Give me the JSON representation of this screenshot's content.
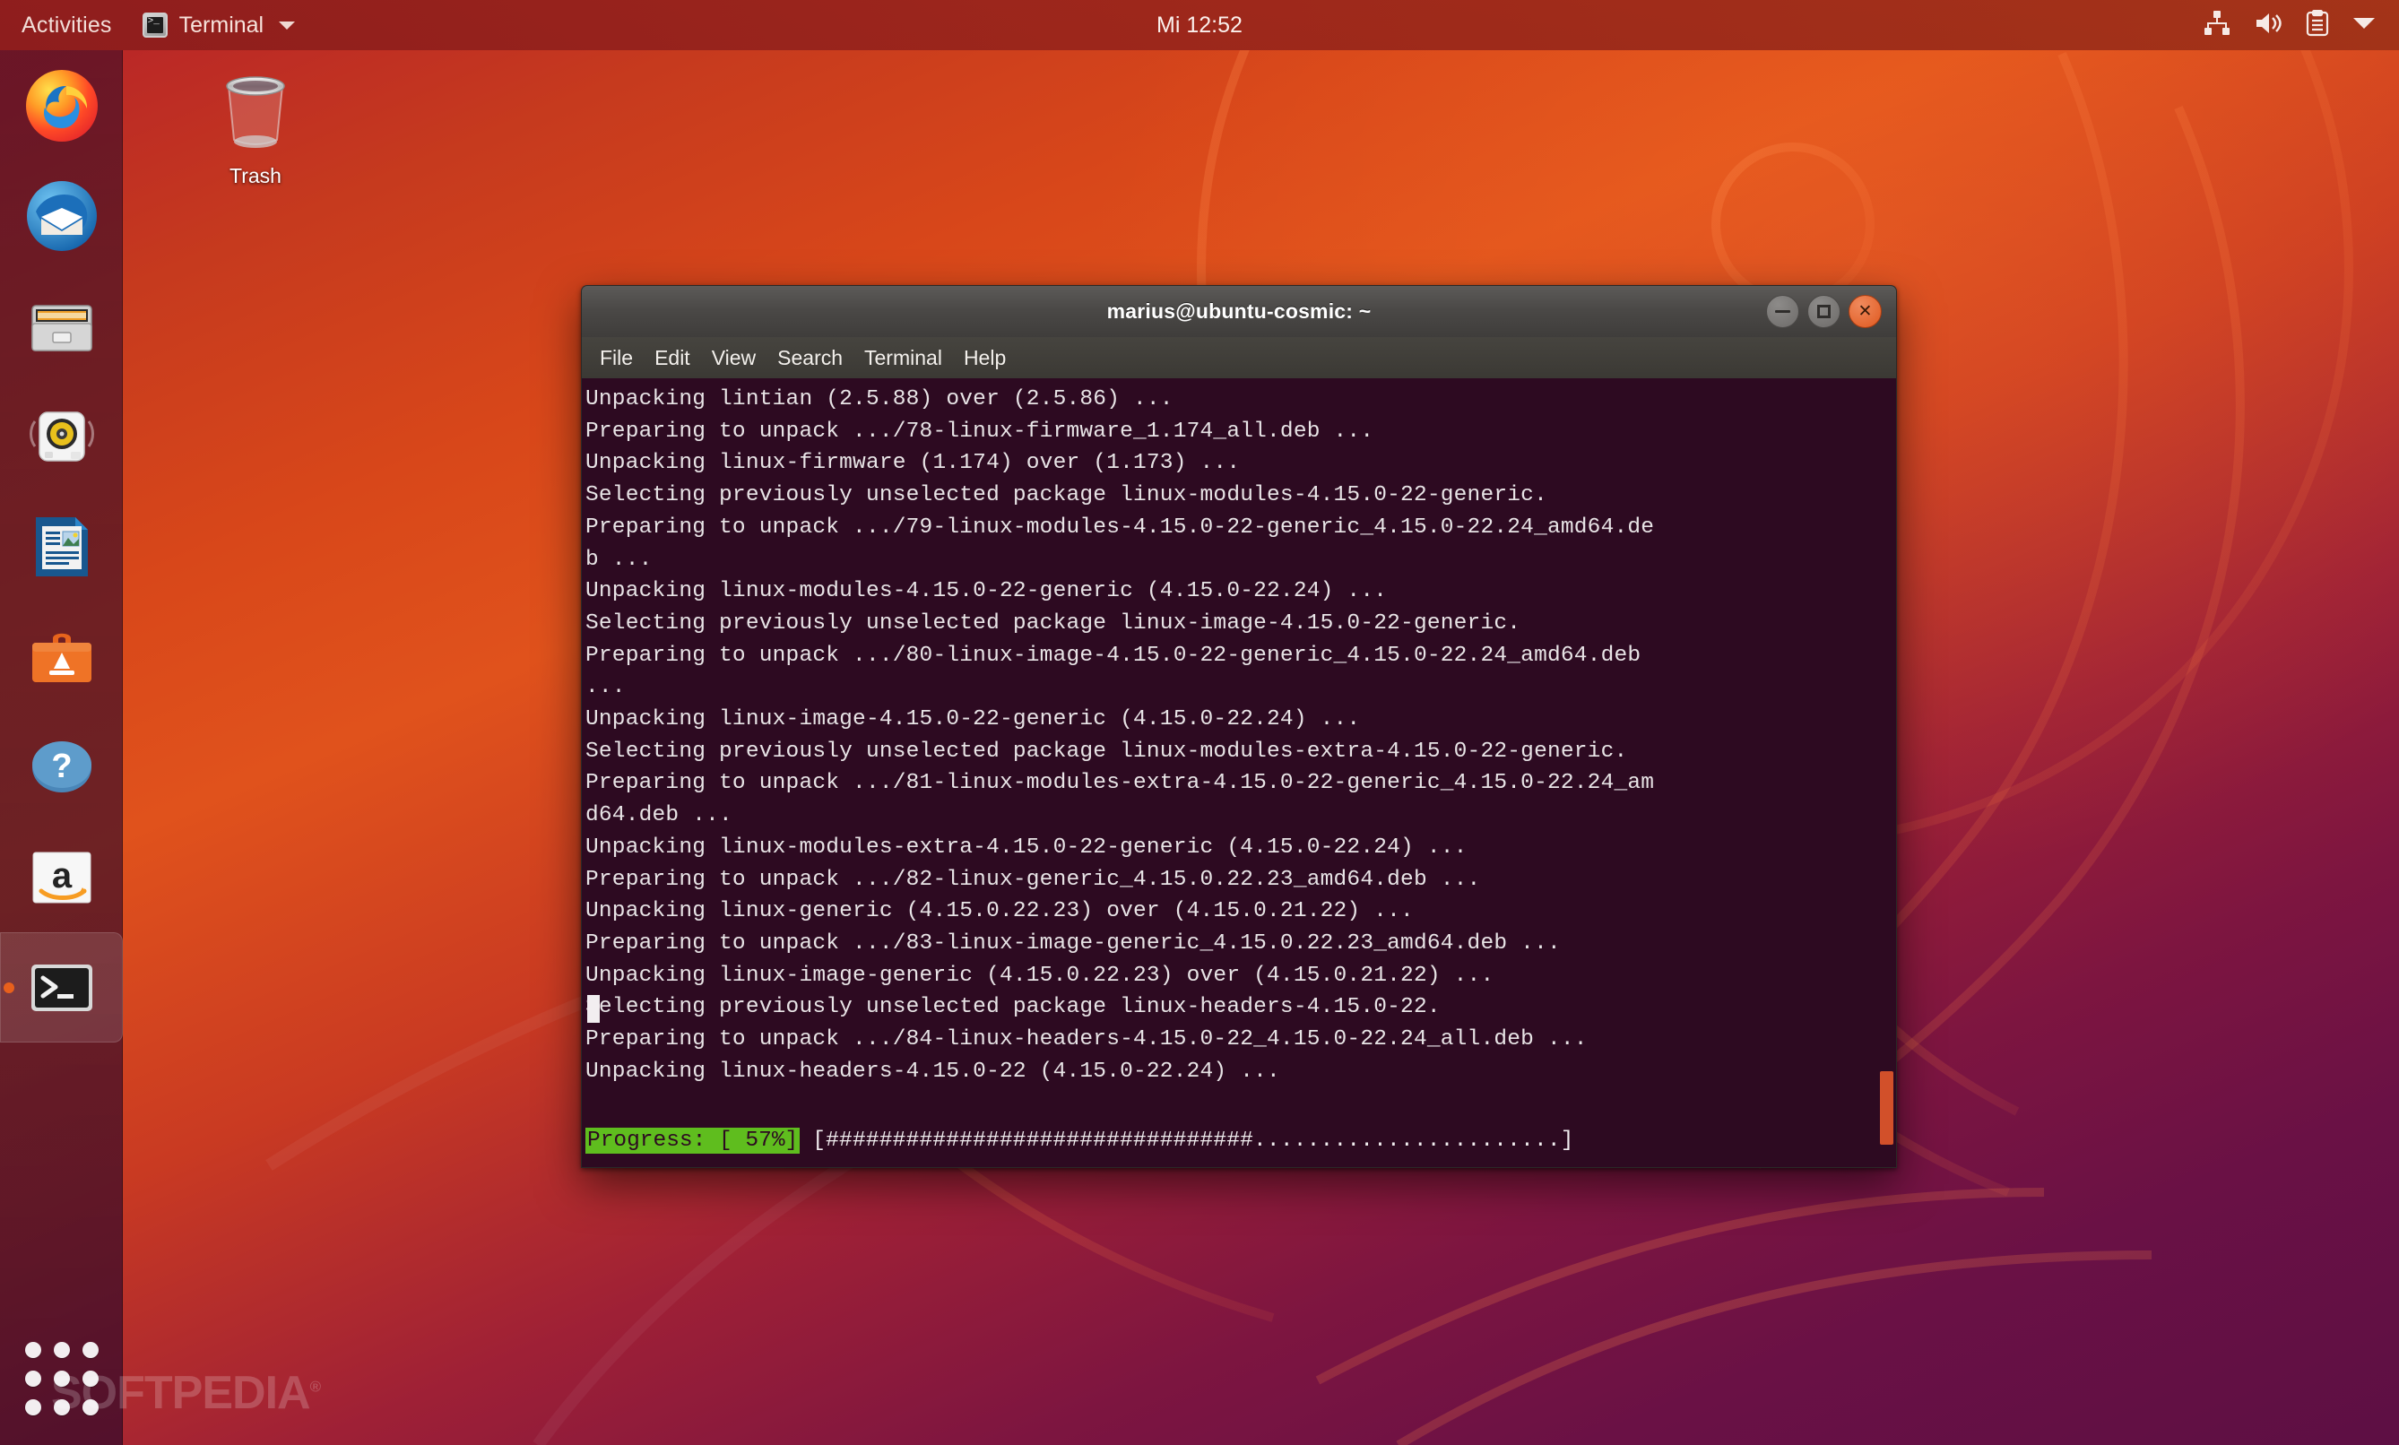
{
  "topbar": {
    "activities": "Activities",
    "app_icon": "terminal-icon",
    "app_name": "Terminal",
    "menu_caret": "chevron-down-icon",
    "clock": "Mi 12:52",
    "tray_icons": [
      "network-icon",
      "volume-icon",
      "clipboard-icon",
      "chevron-down-icon"
    ]
  },
  "launcher": {
    "items": [
      {
        "name": "firefox",
        "label": "Firefox",
        "active": false
      },
      {
        "name": "thunderbird",
        "label": "Thunderbird Mail",
        "active": false
      },
      {
        "name": "files",
        "label": "Files",
        "active": false
      },
      {
        "name": "rhythmbox",
        "label": "Rhythmbox",
        "active": false
      },
      {
        "name": "libreoffice-writer",
        "label": "LibreOffice Writer",
        "active": false
      },
      {
        "name": "ubuntu-software",
        "label": "Ubuntu Software",
        "active": false
      },
      {
        "name": "help",
        "label": "Help",
        "active": false
      },
      {
        "name": "amazon",
        "label": "Amazon",
        "active": false
      },
      {
        "name": "terminal",
        "label": "Terminal",
        "active": true
      }
    ],
    "show_applications": "show-applications-grid"
  },
  "desktop": {
    "icons": [
      {
        "name": "trash",
        "label": "Trash"
      }
    ],
    "watermark": "SOFTPEDIA",
    "watermark_mark": "®"
  },
  "terminal": {
    "title": "marius@ubuntu-cosmic: ~",
    "window_buttons": {
      "minimize": "minimize-icon",
      "maximize": "maximize-icon",
      "close": "close-icon"
    },
    "menu": [
      "File",
      "Edit",
      "View",
      "Search",
      "Terminal",
      "Help"
    ],
    "lines": [
      "Unpacking lintian (2.5.88) over (2.5.86) ...",
      "Preparing to unpack .../78-linux-firmware_1.174_all.deb ...",
      "Unpacking linux-firmware (1.174) over (1.173) ...",
      "Selecting previously unselected package linux-modules-4.15.0-22-generic.",
      "Preparing to unpack .../79-linux-modules-4.15.0-22-generic_4.15.0-22.24_amd64.de",
      "b ...",
      "Unpacking linux-modules-4.15.0-22-generic (4.15.0-22.24) ...",
      "Selecting previously unselected package linux-image-4.15.0-22-generic.",
      "Preparing to unpack .../80-linux-image-4.15.0-22-generic_4.15.0-22.24_amd64.deb",
      "...",
      "Unpacking linux-image-4.15.0-22-generic (4.15.0-22.24) ...",
      "Selecting previously unselected package linux-modules-extra-4.15.0-22-generic.",
      "Preparing to unpack .../81-linux-modules-extra-4.15.0-22-generic_4.15.0-22.24_am",
      "d64.deb ...",
      "Unpacking linux-modules-extra-4.15.0-22-generic (4.15.0-22.24) ...",
      "Preparing to unpack .../82-linux-generic_4.15.0.22.23_amd64.deb ...",
      "Unpacking linux-generic (4.15.0.22.23) over (4.15.0.21.22) ...",
      "Preparing to unpack .../83-linux-image-generic_4.15.0.22.23_amd64.deb ...",
      "Unpacking linux-image-generic (4.15.0.22.23) over (4.15.0.21.22) ...",
      "Selecting previously unselected package linux-headers-4.15.0-22.",
      "Preparing to unpack .../84-linux-headers-4.15.0-22_4.15.0-22.24_all.deb ...",
      "Unpacking linux-headers-4.15.0-22 (4.15.0-22.24) ..."
    ],
    "progress": {
      "label": "Progress: [ 57%]",
      "percent": 57,
      "bar": "[################################.......................]",
      "label_bg": "#5fbd1e"
    },
    "colors": {
      "background": "#2d0a21",
      "foreground": "#e8e4e6",
      "scrollbar_thumb": "#d2502a"
    }
  }
}
